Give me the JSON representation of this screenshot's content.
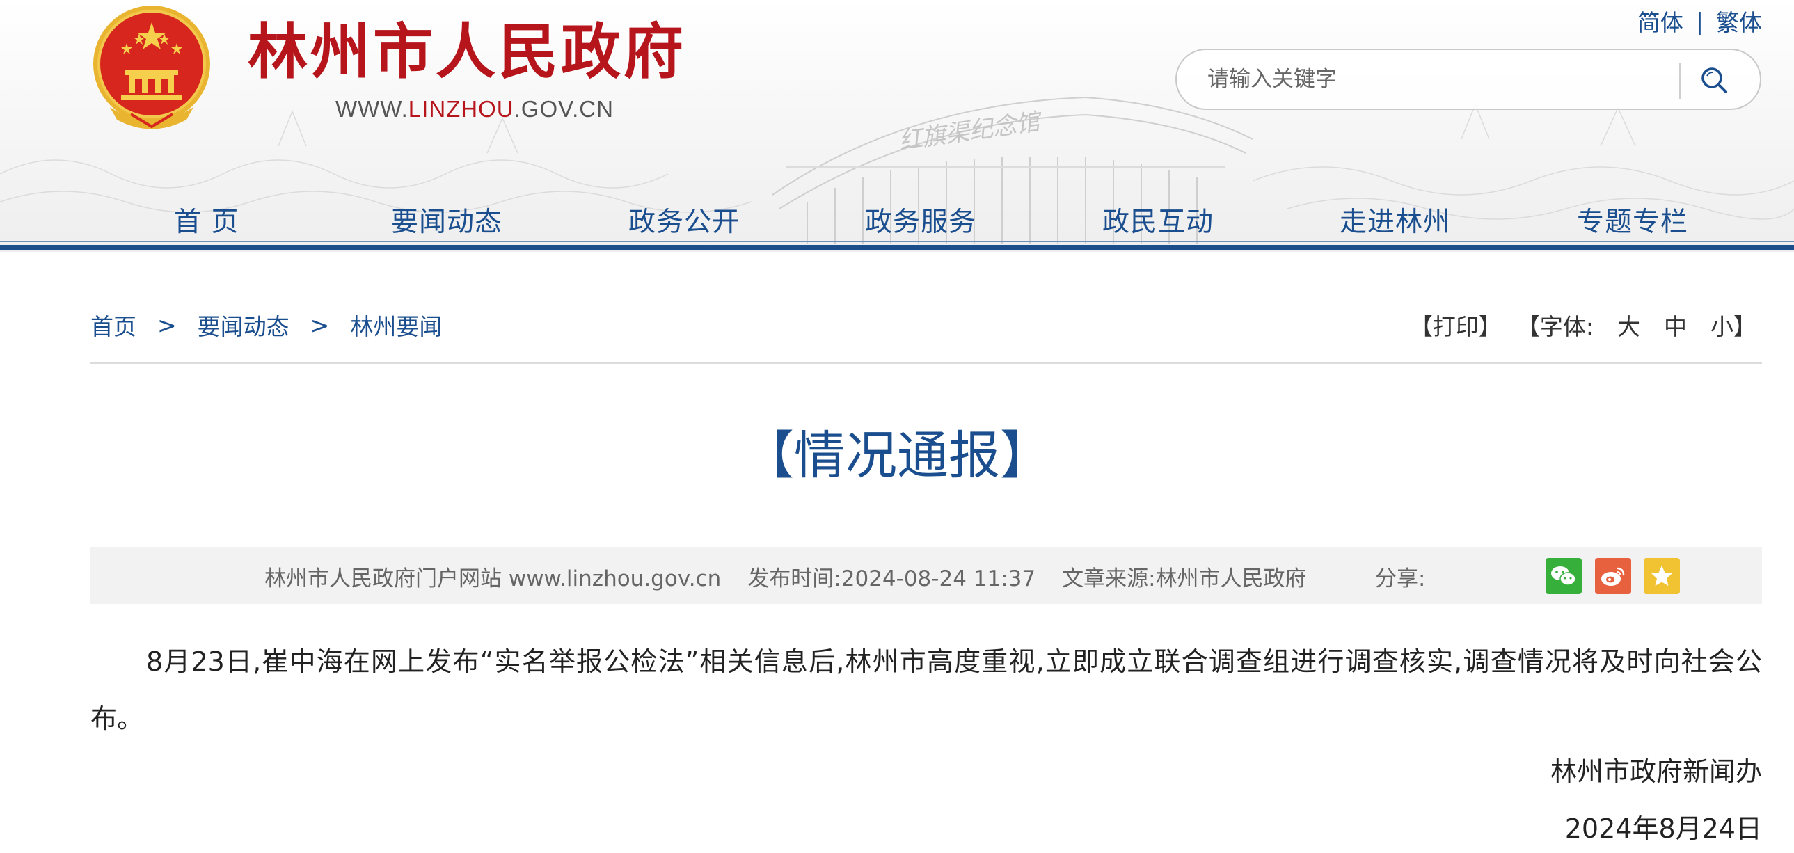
{
  "header": {
    "site_title": "林州市人民政府",
    "url_prefix": "WWW.",
    "url_highlight": "LINZHOU",
    "url_suffix": ".GOV.CN",
    "lang_simplified": "简体",
    "lang_separator": "|",
    "lang_traditional": "繁体",
    "search_placeholder": "请输入关键字",
    "building_sign_text": "红旗渠纪念馆",
    "brand_red": "#b5151b",
    "brand_blue": "#1a4e8e"
  },
  "nav": {
    "items": [
      {
        "label": "首 页"
      },
      {
        "label": "要闻动态"
      },
      {
        "label": "政务公开"
      },
      {
        "label": "政务服务"
      },
      {
        "label": "政民互动"
      },
      {
        "label": "走进林州"
      },
      {
        "label": "专题专栏"
      }
    ]
  },
  "breadcrumb": {
    "items": [
      "首页",
      "要闻动态",
      "林州要闻"
    ],
    "separator": ">"
  },
  "tools": {
    "print": "【打印】",
    "font_label": "【字体:",
    "size_large": "大",
    "size_medium": "中",
    "size_small": "小",
    "font_close": "】"
  },
  "article": {
    "title": "【情况通报】",
    "meta_site": "林州市人民政府门户网站 www.linzhou.gov.cn",
    "meta_time": "发布时间:2024-08-24 11:37",
    "meta_source": "文章来源:林州市人民政府",
    "share_label": "分享:",
    "share_icons": [
      "wechat-icon",
      "weibo-icon",
      "favorite-star-icon"
    ],
    "body": "8月23日,崔中海在网上发布“实名举报公检法”相关信息后,林州市高度重视,立即成立联合调查组进行调查核实,调查情况将及时向社会公布。",
    "signature": "林州市政府新闻办",
    "date": "2024年8月24日"
  }
}
